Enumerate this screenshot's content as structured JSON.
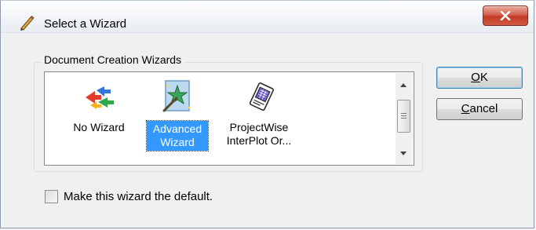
{
  "window": {
    "title": "Select a Wizard",
    "close_label": "X"
  },
  "group": {
    "legend": "Document Creation Wizards",
    "items": [
      {
        "label_line1": "No Wizard",
        "label_line2": "",
        "icon": "puzzle-arrows-icon",
        "selected": false
      },
      {
        "label_line1": "Advanced",
        "label_line2": "Wizard",
        "icon": "star-wand-icon",
        "selected": true
      },
      {
        "label_line1": "ProjectWise",
        "label_line2": "InterPlot Or...",
        "icon": "plot-document-icon",
        "selected": false
      }
    ]
  },
  "buttons": {
    "ok_accel": "O",
    "ok_rest": "K",
    "cancel_accel": "C",
    "cancel_rest": "ancel"
  },
  "checkbox": {
    "label": "Make this wizard the default.",
    "checked": false
  },
  "colors": {
    "selection": "#3399ff",
    "close_button": "#c33a25"
  }
}
